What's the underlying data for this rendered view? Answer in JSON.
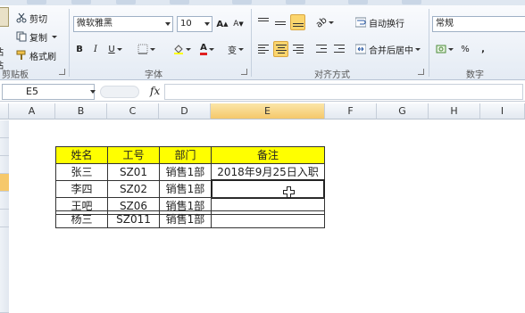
{
  "ribbon": {
    "clipboard": {
      "paste_label": "粘贴",
      "cut_label": "剪切",
      "copy_label": "复制",
      "format_painter_label": "格式刷",
      "group_label": "剪贴板"
    },
    "font": {
      "font_name": "微软雅黑",
      "font_size": "10",
      "bold": "B",
      "italic": "I",
      "underline": "U",
      "font_color_letter": "A",
      "phonetic": "变",
      "grow": "A",
      "shrink": "A",
      "group_label": "字体"
    },
    "alignment": {
      "wrap_text_label": "自动换行",
      "merge_center_label": "合并后居中",
      "group_label": "对齐方式"
    },
    "number": {
      "format_value": "常规",
      "percent": "%",
      "comma": ",",
      "group_label": "数字"
    }
  },
  "formula_bar": {
    "name_box": "E5",
    "fx_label": "fx",
    "formula": ""
  },
  "columns": [
    "A",
    "B",
    "C",
    "D",
    "E",
    "F",
    "G",
    "H",
    "I"
  ],
  "table": {
    "headers": [
      "姓名",
      "工号",
      "部门",
      "备注"
    ],
    "rows": [
      [
        "张三",
        "SZ01",
        "销售1部",
        "2018年9月25日入职"
      ],
      [
        "李四",
        "SZ02",
        "销售1部",
        ""
      ],
      [
        "王吧",
        "SZ06",
        "销售1部",
        ""
      ],
      [
        "杨三",
        "SZ011",
        "销售1部",
        ""
      ]
    ]
  },
  "colors": {
    "header_fill": "#ffff00",
    "selected_header": "#f5c86b",
    "ribbon_bg": "#e4ebf4"
  }
}
